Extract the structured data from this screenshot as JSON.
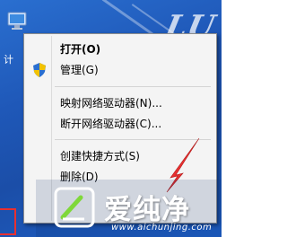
{
  "desktop": {
    "watermark_text": "LU",
    "icon_label": "计"
  },
  "context_menu": {
    "items": [
      {
        "label": "打开(O)",
        "bold": true
      },
      {
        "label": "管理(G)",
        "icon": "shield-icon"
      },
      {
        "label": "映射网络驱动器(N)..."
      },
      {
        "label": "断开网络驱动器(C)..."
      },
      {
        "label": "创建快捷方式(S)"
      },
      {
        "label": "删除(D)"
      }
    ]
  },
  "brand": {
    "name": "爱纯净",
    "url": "www.aichunjing.com"
  },
  "colors": {
    "desktop_blue": "#1f58b8",
    "menu_bg": "#f4f4f4",
    "red_arrow": "#e83030",
    "shield_blue": "#2a6fd0",
    "shield_yellow": "#f2c200"
  }
}
